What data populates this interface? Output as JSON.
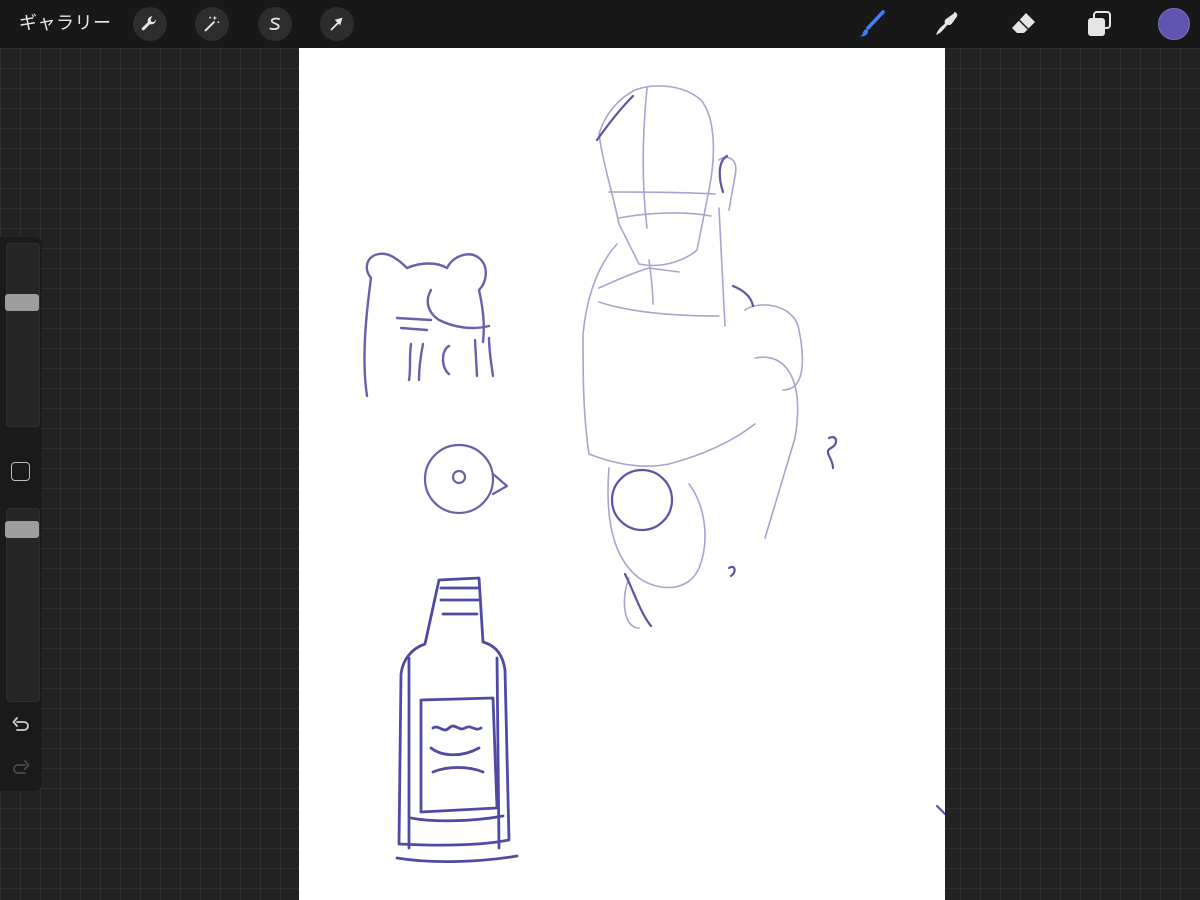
{
  "topbar": {
    "gallery_label": "ギャラリー",
    "left_tools": [
      {
        "name": "actions",
        "icon": "wrench-icon"
      },
      {
        "name": "adjustments",
        "icon": "magic-wand-icon"
      },
      {
        "name": "selection",
        "icon": "selection-s-icon"
      },
      {
        "name": "transform",
        "icon": "arrow-cursor-icon"
      }
    ],
    "right_tools": [
      {
        "name": "brush",
        "icon": "brush-icon",
        "active": true
      },
      {
        "name": "smudge",
        "icon": "smudge-finger-icon",
        "active": false
      },
      {
        "name": "eraser",
        "icon": "eraser-icon",
        "active": false
      },
      {
        "name": "layers",
        "icon": "layers-icon",
        "active": false
      }
    ],
    "current_color": "#5f55b0"
  },
  "sidebar": {
    "brush_size_level": 0.7,
    "opacity_level": 0.93,
    "modify_icon": "square-outline-icon",
    "undo_icon": "undo-arrow-icon",
    "redo_icon": "redo-arrow-icon"
  },
  "colors": {
    "accent_active": "#3f82f7",
    "ink": "#5b55a6",
    "ink_light": "#a7a4cf"
  }
}
